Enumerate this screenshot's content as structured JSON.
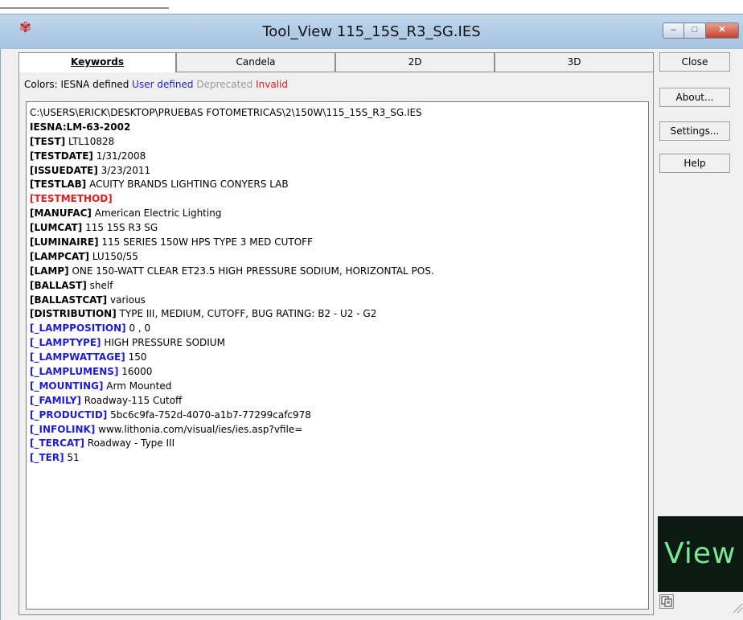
{
  "window": {
    "title": "Tool_View 115_15S_R3_SG.IES"
  },
  "caption_buttons": {
    "minimize": "–",
    "maximize": "□",
    "close": "✕"
  },
  "tabs": [
    {
      "label": "Keywords",
      "active": true
    },
    {
      "label": "Candela",
      "active": false
    },
    {
      "label": "2D",
      "active": false
    },
    {
      "label": "3D",
      "active": false
    }
  ],
  "legend": {
    "prefix": "Colors: IESNA defined",
    "user": "User defined",
    "deprecated": "Deprecated",
    "invalid": "Invalid"
  },
  "colors": {
    "user": "#1c1cd4",
    "invalid": "#e11d1d",
    "deprecated": "#9a9a9a",
    "logo_bg": "#0b1a12",
    "logo_text": "#78e894"
  },
  "file": {
    "path": "C:\\USERS\\ERICK\\DESKTOP\\PRUEBAS FOTOMETRICAS\\2\\150W\\115_15S_R3_SG.IES",
    "format": "IESNA:LM-63-2002",
    "lines": [
      {
        "kw": "[TEST]",
        "val": "LTL10828",
        "kind": "iesna"
      },
      {
        "kw": "[TESTDATE]",
        "val": "1/31/2008",
        "kind": "iesna"
      },
      {
        "kw": "[ISSUEDATE]",
        "val": "3/23/2011",
        "kind": "iesna"
      },
      {
        "kw": "[TESTLAB]",
        "val": "ACUITY BRANDS LIGHTING CONYERS LAB",
        "kind": "iesna"
      },
      {
        "kw": "[TESTMETHOD]",
        "val": "",
        "kind": "invalid"
      },
      {
        "kw": "[MANUFAC]",
        "val": "American Electric Lighting",
        "kind": "iesna"
      },
      {
        "kw": "[LUMCAT]",
        "val": "115 15S R3 SG",
        "kind": "iesna"
      },
      {
        "kw": "[LUMINAIRE]",
        "val": "115 SERIES 150W HPS TYPE 3 MED CUTOFF",
        "kind": "iesna"
      },
      {
        "kw": "[LAMPCAT]",
        "val": "LU150/55",
        "kind": "iesna"
      },
      {
        "kw": "[LAMP]",
        "val": "ONE  150-WATT CLEAR ET23.5 HIGH PRESSURE SODIUM, HORIZONTAL POS.",
        "kind": "iesna"
      },
      {
        "kw": "[BALLAST]",
        "val": "shelf",
        "kind": "iesna"
      },
      {
        "kw": "[BALLASTCAT]",
        "val": "various",
        "kind": "iesna"
      },
      {
        "kw": "[DISTRIBUTION]",
        "val": "TYPE III, MEDIUM, CUTOFF, BUG RATING: B2 - U2 - G2",
        "kind": "iesna"
      },
      {
        "kw": "[_LAMPPOSITION]",
        "val": "0 , 0",
        "kind": "user"
      },
      {
        "kw": "[_LAMPTYPE]",
        "val": "HIGH PRESSURE SODIUM",
        "kind": "user"
      },
      {
        "kw": "[_LAMPWATTAGE]",
        "val": "150",
        "kind": "user"
      },
      {
        "kw": "[_LAMPLUMENS]",
        "val": "16000",
        "kind": "user"
      },
      {
        "kw": "[_MOUNTING]",
        "val": "Arm Mounted",
        "kind": "user"
      },
      {
        "kw": "[_FAMILY]",
        "val": "Roadway-115 Cutoff",
        "kind": "user"
      },
      {
        "kw": "[_PRODUCTID]",
        "val": "5bc6c9fa-752d-4070-a1b7-77299cafc978",
        "kind": "user"
      },
      {
        "kw": "[_INFOLINK]",
        "val": "www.lithonia.com/visual/ies/ies.asp?vfile=",
        "kind": "user"
      },
      {
        "kw": "[_TERCAT]",
        "val": "Roadway - Type III",
        "kind": "user"
      },
      {
        "kw": "[_TER]",
        "val": "51",
        "kind": "user"
      }
    ]
  },
  "buttons": {
    "close": "Close",
    "about": "About...",
    "settings": "Settings...",
    "help": "Help"
  },
  "logo": {
    "text": "View"
  }
}
